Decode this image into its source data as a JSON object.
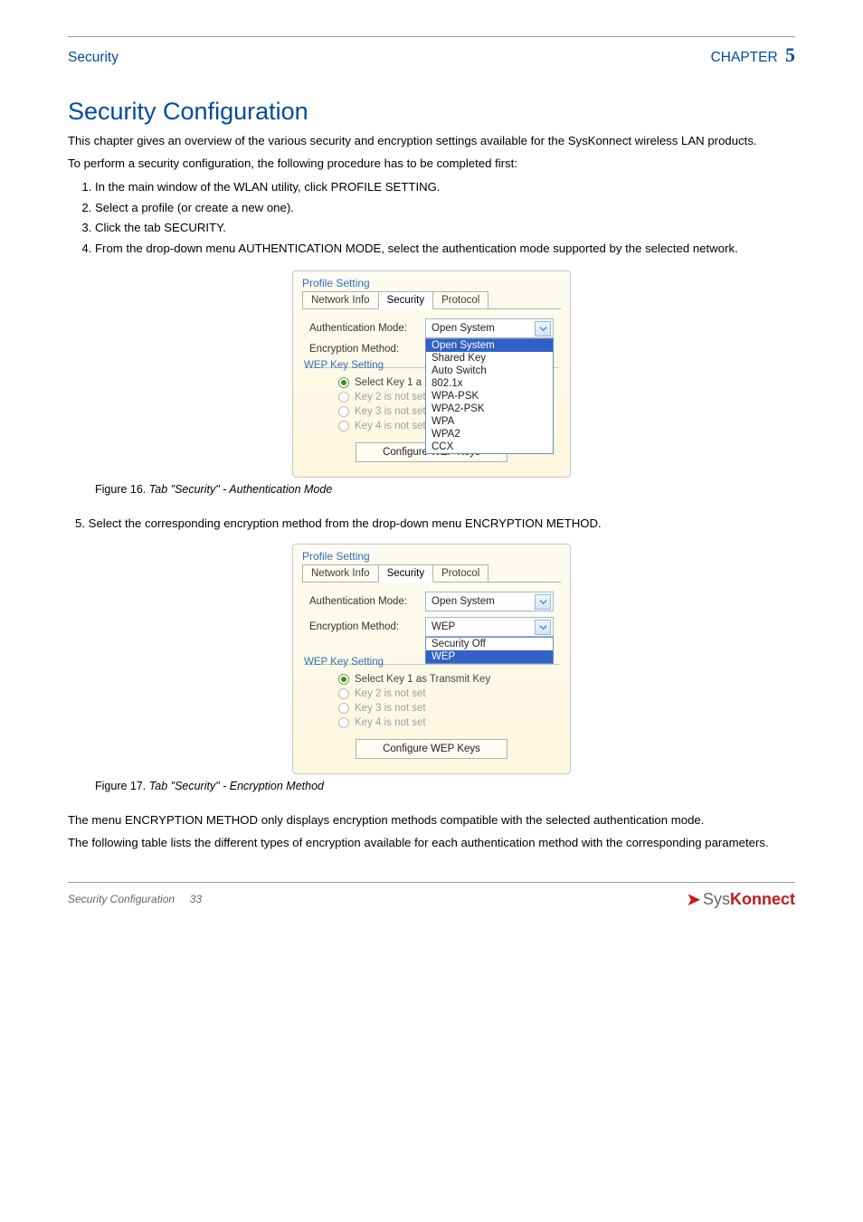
{
  "header": {
    "security": "Security",
    "chapter_label": "CHAPTER",
    "chapter_num": "5"
  },
  "section": {
    "title": "Security Configuration",
    "intro": "This chapter gives an overview of the various security and encryption settings available for the SysKonnect wireless LAN products.",
    "prereq_lead": "To perform a security configuration, the following procedure has to be completed first:",
    "steps": [
      "In the main window of the WLAN utility, click PROFILE SETTING.",
      "Select a profile (or create a new one).",
      "Click the tab SECURITY.",
      "From the drop-down menu AUTHENTICATION MODE, select the authentication mode supported by the selected network."
    ]
  },
  "figures": [
    {
      "num": "Figure 16.",
      "title": "Tab \"Security\" - Authentication Mode"
    },
    {
      "num": "Figure 17.",
      "title": "Tab \"Security\" - Encryption Method"
    }
  ],
  "mid_step": "5.   Select the corresponding encryption method from the drop-down menu ENCRYPTION METHOD.",
  "after_para": [
    "The menu ENCRYPTION METHOD only displays encryption methods compatible with the selected authentication mode.",
    "The following table lists the different types of encryption available for each authentication method with the corresponding parameters."
  ],
  "dialog": {
    "fieldset": "Profile Setting",
    "tabs": {
      "network": "Network Info",
      "security": "Security",
      "protocol": "Protocol"
    },
    "auth_label": "Authentication Mode:",
    "enc_label": "Encryption Method:",
    "auth_value": "Open System",
    "enc_value_wep": "WEP",
    "auth_options": [
      "Open System",
      "Shared Key",
      "Auto Switch",
      "802.1x",
      "WPA-PSK",
      "WPA2-PSK",
      "WPA",
      "WPA2",
      "CCX"
    ],
    "enc_options": [
      "Security Off",
      "WEP"
    ],
    "wep_legend": "WEP Key Setting",
    "radios": {
      "k1_partial": "Select Key 1 a",
      "k1_full": "Select Key 1 as Transmit Key",
      "k2": "Key 2 is not set",
      "k3": "Key 3 is not set",
      "k4": "Key 4 is not set"
    },
    "cfg_button": "Configure WEP Keys"
  },
  "footer": {
    "left": "Security Configuration",
    "page": "33",
    "brand_sys": "Sys",
    "brand_kon": "Konnect"
  }
}
